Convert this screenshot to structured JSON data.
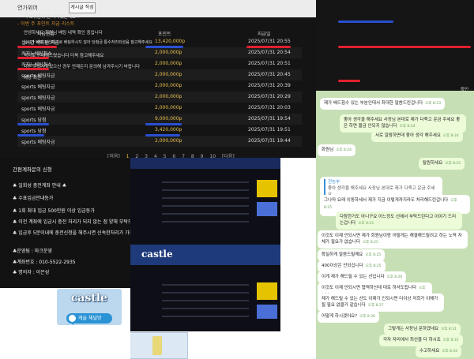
{
  "left_panel": {
    "bar_label": "연가위어",
    "write_button": "게시글 작성",
    "list_title": "- 이번 주 포인트 지급 리스트",
    "headers": [
      "지급현황",
      "포인트",
      "지급일"
    ],
    "rows": [
      {
        "type": "실시간 박히원 지급",
        "points": "13,420,000p",
        "date": "2025/07/31 20:55"
      },
      {
        "type": "카지노베팅취소",
        "points": "2,000,000p",
        "date": "2025/07/31 20:54"
      },
      {
        "type": "카지노베팅취소",
        "points": "2,000,000p",
        "date": "2025/07/31 20:51"
      },
      {
        "type": "sports 베팅자금",
        "points": "2,000,000p",
        "date": "2025/07/31 20:45"
      },
      {
        "type": "sports 베팅자금",
        "points": "2,000,000p",
        "date": "2025/07/31 20:39"
      },
      {
        "type": "sports 베팅자금",
        "points": "2,000,000p",
        "date": "2025/07/31 20:29"
      },
      {
        "type": "sports 베팅자금",
        "points": "2,000,000p",
        "date": "2025/07/31 20:03"
      },
      {
        "type": "sports 당첨",
        "points": "9,000,000p",
        "date": "2025/07/31 19:54"
      },
      {
        "type": "sports 당첨",
        "points": "3,420,000p",
        "date": "2025/07/31 19:51"
      },
      {
        "type": "sports 베팅자금",
        "points": "2,000,000p",
        "date": "2025/07/31 19:44"
      }
    ],
    "pager": [
      "[처음]",
      "1",
      "2",
      "3",
      "4",
      "5",
      "6",
      "7",
      "8",
      "9",
      "10",
      "[다음]"
    ]
  },
  "info_panel": {
    "title": "간편계좌문의 신청",
    "lines": [
      "♣ 일회성 충전계좌 안내 ♣",
      "♣ 수표입금안내동가",
      "♣ 1회 최대 입금 500만원 이상 입금동가",
      "♣ 이전 계좌에 입금시 충전 처리가 되지 않는 점 양해 부탁드리겠습니다",
      "♣ 입금후 5분이내에 충전신청을 해주시면 신속한처리가 가능합니다",
      "♣운영팀 : 마크운영",
      "♣계좌번호 : 010-5522-2935",
      "♣ 명의자 : 이은성"
    ]
  },
  "promo": {
    "brand": "castle",
    "telegram_button": "캐슬 채널방"
  },
  "notice_panel": {
    "lines": [
      "저 보유금이 왠 사라졌는데요 ?",
      "안녕하세요 회원님 베팅 내역 확인 중입니다",
      "실시간 베팅 정산처리로 베팅하시지 않아 당첨금 통수처리되셨음 참고해주세요",
      "먹지로 안내해드렸습니다 더욱 참고해주세요",
      "다른 문의사항있으신 경우 언제든지 문의해 남겨주시기 바랍니다",
      "해당 회원"
    ],
    "confirm": "확인"
  },
  "chat": {
    "messages": [
      {
        "text": "제가 배드힘수 있는 부분인데서 최대한 말씀드린겁니다",
        "time": "오후 8:23"
      },
      {
        "text": "좋아 생각을 해주세요 사장님 본대로 제가 다죽고 운금 주세요 좋은 하면 물금 안되지 않습니다",
        "time": "오후 8:24"
      },
      {
        "text": "서로 알람하면데 좋아 생각 해주세요",
        "time": "오후 8:24"
      },
      {
        "text": "화원님",
        "time": "오후 8:24"
      },
      {
        "text": "탈원하세요",
        "time": "오후 8:25"
      },
      {
        "text": "이건 지금 상황이면 야금이 빠르니까 좋다 세우지 결정",
        "time": "오후 8:25"
      },
      {
        "text": "그나마 요래 이동하세서 제가 지금 이렇게까지라도 처리해드린겁니다",
        "time": "오후 8:25"
      },
      {
        "text": "다참한거도 아니구요 어느정도 선에서 부탁드린다고 이야기 드리는겁니다",
        "time": "오후 8:25"
      },
      {
        "text": "이것도 이제 안되시면 제가 회원님이랑 어떻게는 해결해드릴려고 하는 노력 자체가 필요가 없습니다",
        "time": "오후 8:25"
      },
      {
        "text": "확실하게 말씀드릴께요",
        "time": "오후 8:25"
      },
      {
        "text": "400이상은 안되십니다",
        "time": "오후 8:25"
      },
      {
        "text": "이게 제가 해드릴 수 있는 선입니다",
        "time": "오후 8:26"
      },
      {
        "text": "이것도 이제 안되시면 협력하신데 대로 하셔도됩니다",
        "time": "오후 8:26"
      },
      {
        "text": "제가 해드릴 수 있는 선도 이제가 인되시면 더이상 저희가 이해가 될 필요 없을거 같습니다",
        "time": "오후 8:27"
      },
      {
        "text": "어떻게 하시겠어요?",
        "time": "오후 8:30"
      },
      {
        "text": "그렇게는 사장님 문하겠네요",
        "time": "오후 8:31"
      },
      {
        "text": "각자 자리에서 최선을 다 하시죠",
        "time": "오후 8:31"
      },
      {
        "text": "수고하세요",
        "time": "오후 8:32"
      }
    ],
    "reply_label": "전능부",
    "reply_quote": "좋아 생각을 해주세요 사장님 본대로 제가 다죽고 운금 주세요"
  }
}
